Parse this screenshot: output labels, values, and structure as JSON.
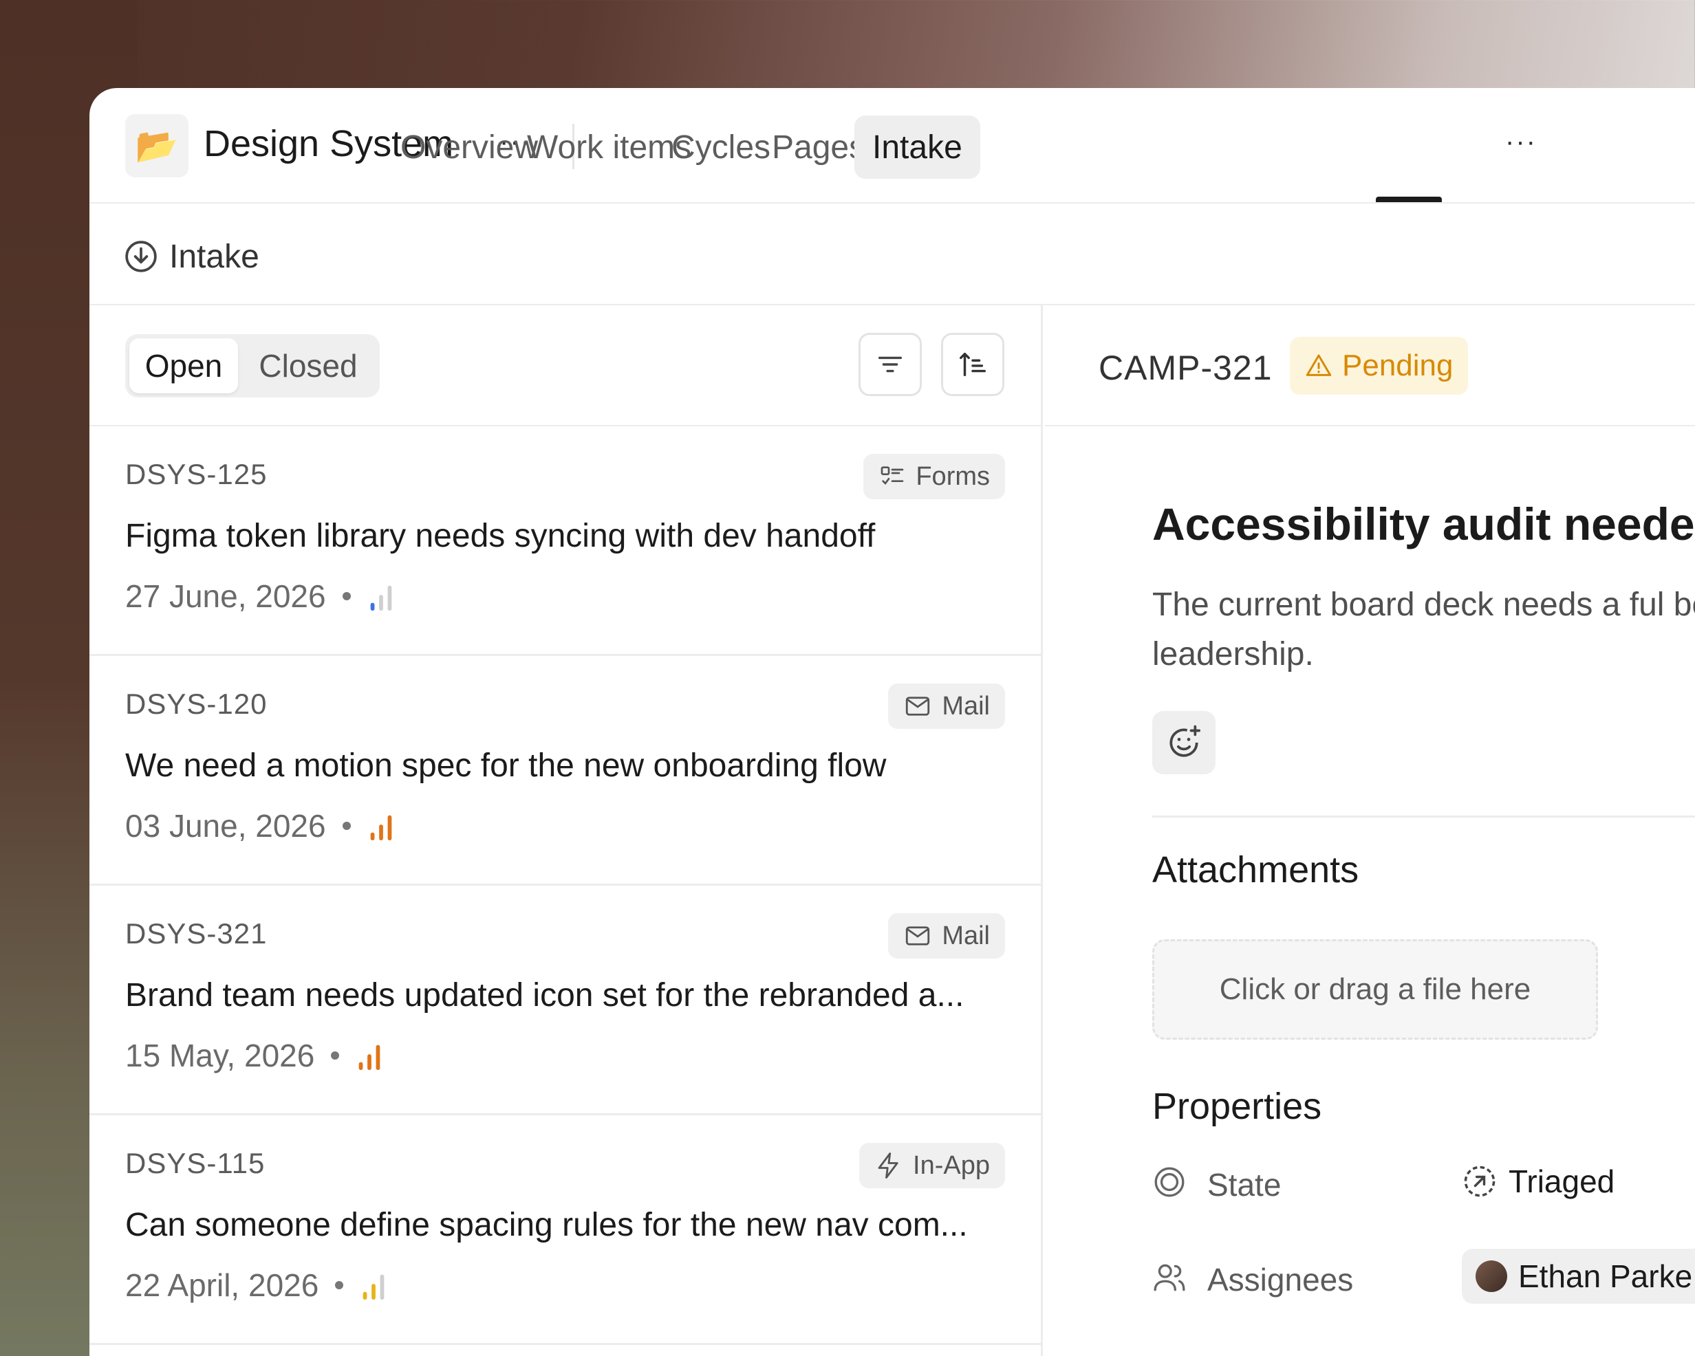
{
  "project": {
    "icon": "folder-icon",
    "title": "Design System"
  },
  "nav": {
    "tabs": [
      "Overview",
      "Work items",
      "Cycles",
      "Pages",
      "Intake"
    ],
    "active": "Intake"
  },
  "subheader": {
    "label": "Intake",
    "icon": "intake-icon"
  },
  "list": {
    "filter_tabs": [
      "Open",
      "Closed"
    ],
    "active_filter": "Open",
    "items": [
      {
        "id": "DSYS-125",
        "source": "Forms",
        "source_icon": "forms-icon",
        "title": "Figma token library needs syncing with dev handoff",
        "date": "27 June, 2026",
        "priority": "low",
        "priority_color": "#3b74e0"
      },
      {
        "id": "DSYS-120",
        "source": "Mail",
        "source_icon": "mail-icon",
        "title": "We need a motion spec for the new onboarding flow",
        "date": "03 June, 2026",
        "priority": "high",
        "priority_color": "#e0741a"
      },
      {
        "id": "DSYS-321",
        "source": "Mail",
        "source_icon": "mail-icon",
        "title": "Brand team needs updated icon set for the rebranded a...",
        "date": "15 May, 2026",
        "priority": "high",
        "priority_color": "#e0741a"
      },
      {
        "id": "DSYS-115",
        "source": "In-App",
        "source_icon": "lightning-icon",
        "title": "Can someone define spacing rules for the new nav com...",
        "date": "22 April, 2026",
        "priority": "medium",
        "priority_color": "#e8b21a"
      }
    ]
  },
  "detail": {
    "id": "CAMP-321",
    "status": "Pending",
    "status_color": "#d78a05",
    "title": "Accessibility audit neede",
    "description": "The current board deck needs a ful be provided by leadership.",
    "attachments_title": "Attachments",
    "dropzone_text": "Click or drag a file here",
    "properties_title": "Properties",
    "properties": [
      {
        "label": "State",
        "value": "Triaged"
      },
      {
        "label": "Assignees",
        "value": "Ethan Parke"
      }
    ]
  }
}
